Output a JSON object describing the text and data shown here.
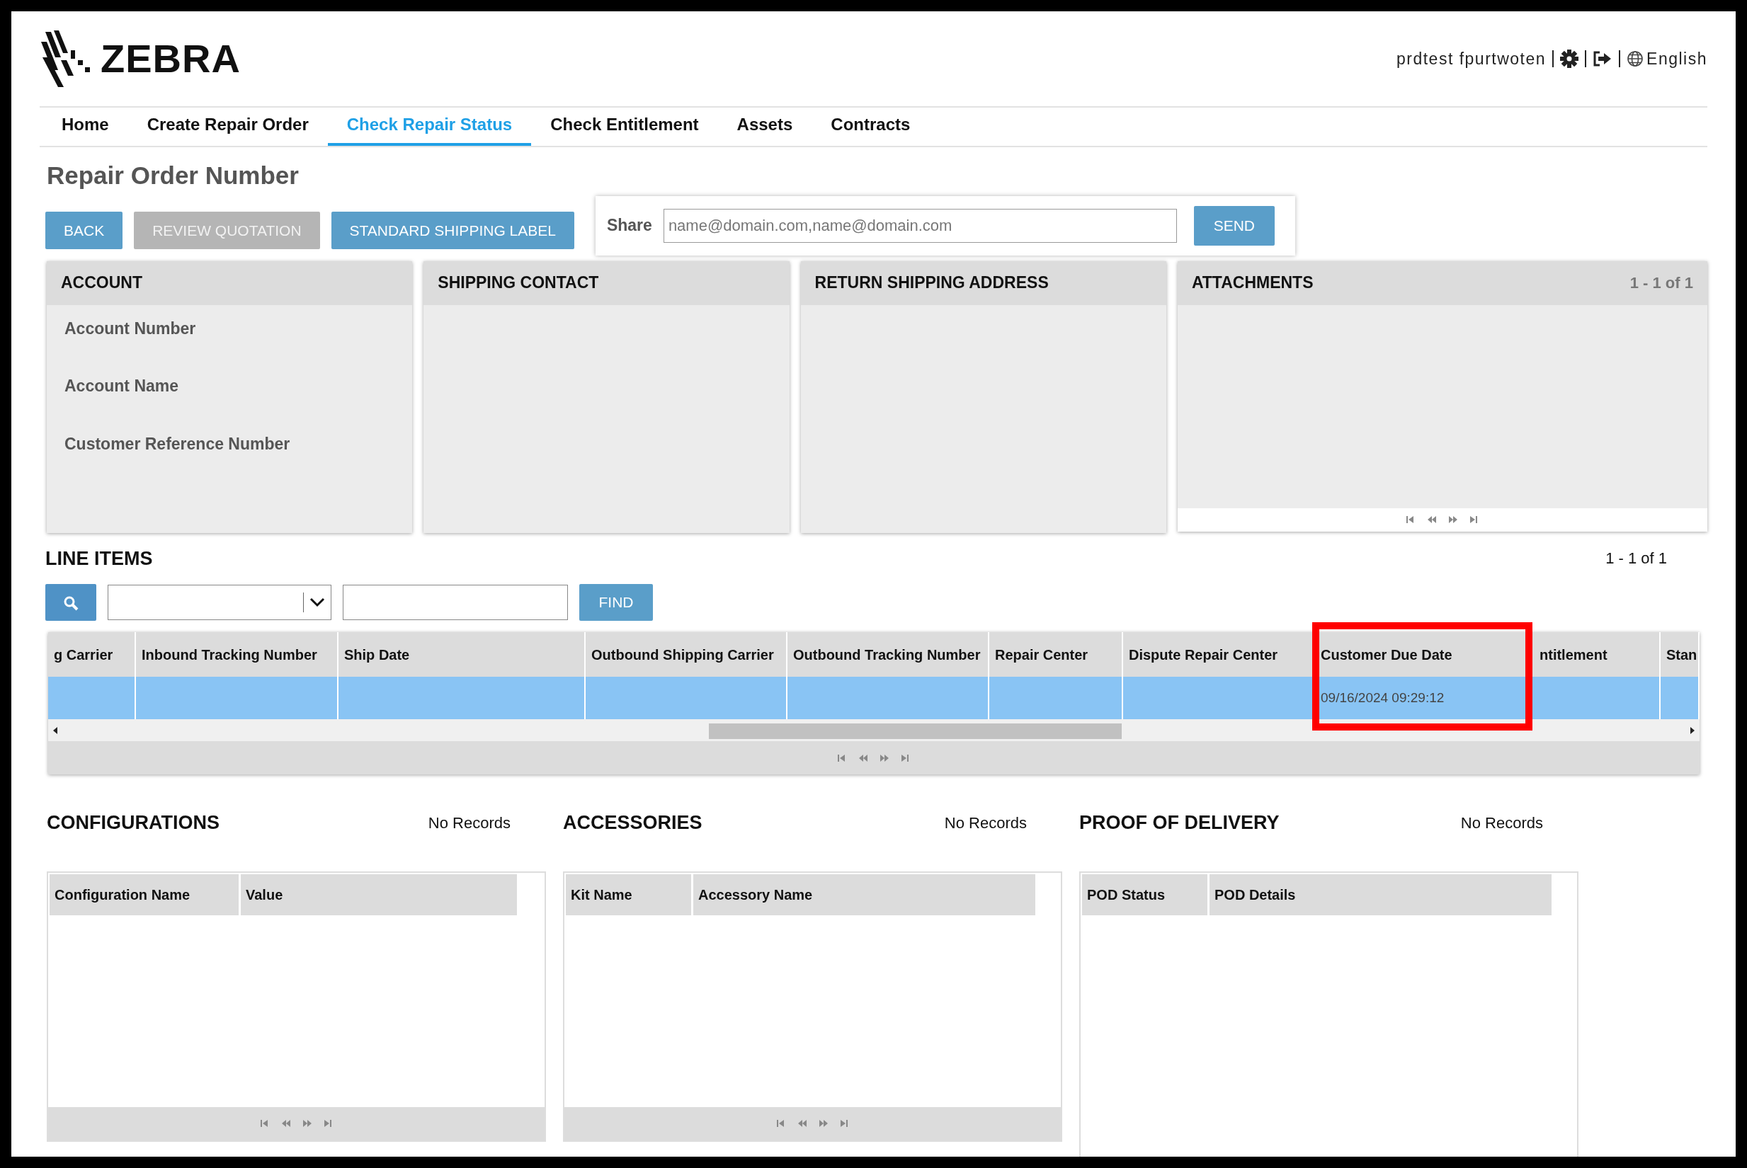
{
  "header": {
    "logo_text": "ZEBRA",
    "user": "prdtest fpurtwoten",
    "language": "English"
  },
  "nav": [
    {
      "label": "Home",
      "selected": false
    },
    {
      "label": "Create Repair Order",
      "selected": false
    },
    {
      "label": "Check Repair Status",
      "selected": true
    },
    {
      "label": "Check Entitlement",
      "selected": false
    },
    {
      "label": "Assets",
      "selected": false
    },
    {
      "label": "Contracts",
      "selected": false
    }
  ],
  "page_title": "Repair Order Number",
  "actions": [
    {
      "label": "BACK",
      "disabled": false
    },
    {
      "label": "REVIEW QUOTATION",
      "disabled": true
    },
    {
      "label": "STANDARD SHIPPING LABEL",
      "disabled": false
    }
  ],
  "share": {
    "label": "Share",
    "placeholder": "name@domain.com,name@domain.com",
    "button": "SEND"
  },
  "panels": [
    {
      "title": "ACCOUNT",
      "fields": [
        "Account Number",
        "Account Name",
        "Customer Reference Number"
      ]
    },
    {
      "title": "SHIPPING CONTACT"
    },
    {
      "title": "RETURN SHIPPING ADDRESS"
    }
  ],
  "attachments": {
    "title": "ATTACHMENTS",
    "count": "1 - 1 of 1"
  },
  "line_items": {
    "title": "LINE ITEMS",
    "count": "1 - 1 of 1",
    "find_button": "FIND",
    "columns": [
      {
        "label": "g Carrier",
        "highlighted": false
      },
      {
        "label": "Inbound Tracking Number",
        "highlighted": false
      },
      {
        "label": "Ship Date",
        "highlighted": false
      },
      {
        "label": "Outbound Shipping Carrier",
        "highlighted": false
      },
      {
        "label": "Outbound Tracking Number",
        "highlighted": false
      },
      {
        "label": "Repair Center",
        "highlighted": false
      },
      {
        "label": "Dispute Repair Center",
        "highlighted": false
      },
      {
        "label": "Customer Due Date",
        "highlighted": true
      },
      {
        "label": "ntitlement",
        "highlighted": false
      },
      {
        "label": "Stan",
        "highlighted": false
      }
    ],
    "rows": [
      {
        "selected": true,
        "cells": [
          null,
          null,
          null,
          null,
          null,
          null,
          null,
          "09/16/2024 09:29:12",
          null,
          null
        ]
      }
    ]
  },
  "sections": [
    {
      "title": "CONFIGURATIONS",
      "status": "No Records",
      "columns": [
        "Configuration Name",
        "Value"
      ],
      "pager": true
    },
    {
      "title": "ACCESSORIES",
      "status": "No Records",
      "columns": [
        "Kit Name",
        "Accessory Name"
      ],
      "pager": true
    },
    {
      "title": "PROOF OF DELIVERY",
      "status": "No Records",
      "columns": [
        "POD Status",
        "POD Details"
      ],
      "pager": false
    }
  ]
}
